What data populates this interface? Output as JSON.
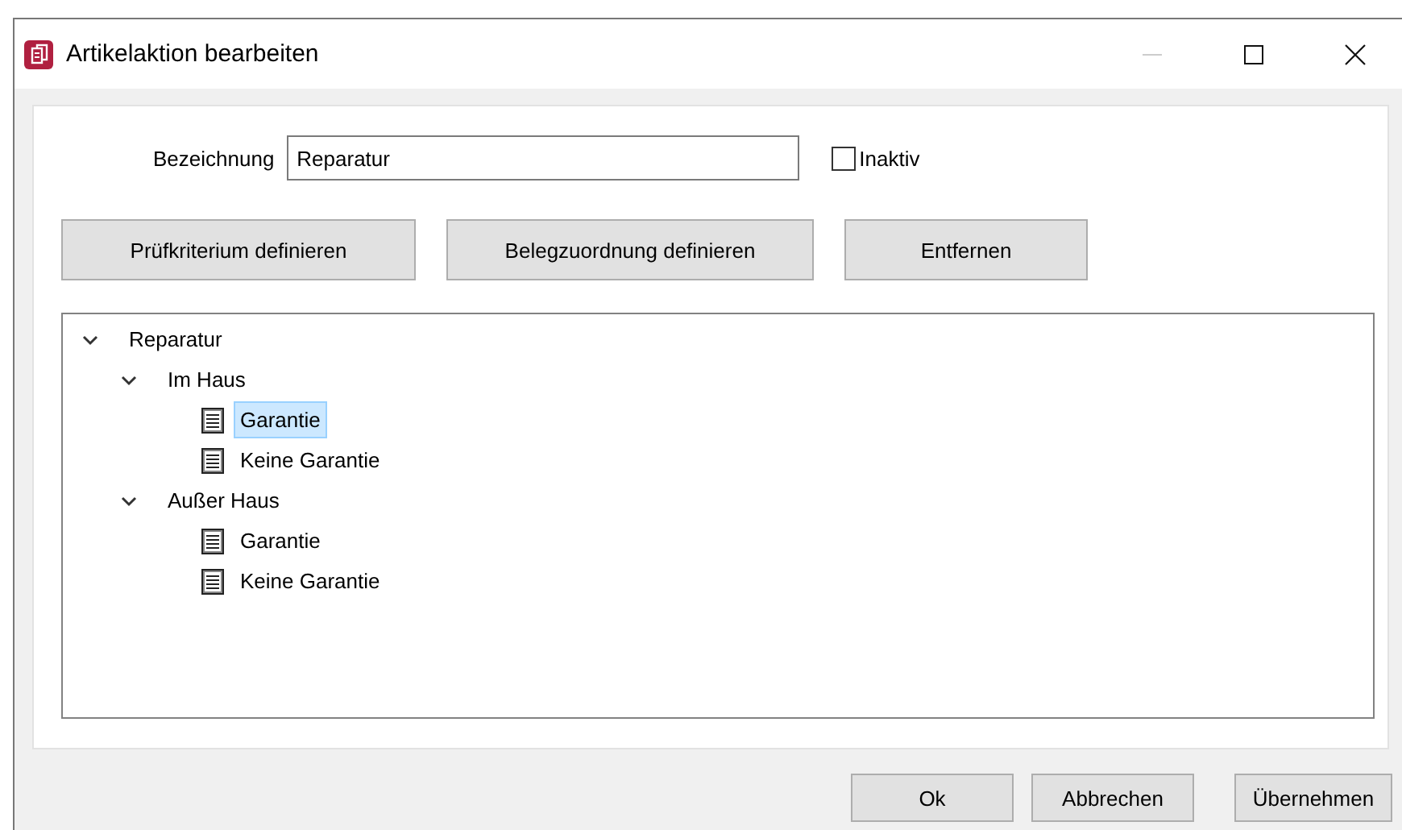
{
  "window": {
    "title": "Artikelaktion bearbeiten"
  },
  "bezeichnung": {
    "label": "Bezeichnung",
    "value": "Reparatur"
  },
  "inaktiv": {
    "label": "Inaktiv",
    "checked": false
  },
  "actions": [
    "Prüfkriterium definieren",
    "Belegzuordnung definieren",
    "Entfernen"
  ],
  "tree": [
    {
      "label": "Reparatur",
      "kind": "folder",
      "expanded": true,
      "selected": false,
      "children": [
        {
          "label": "Im Haus",
          "kind": "folder",
          "expanded": true,
          "selected": false,
          "children": [
            {
              "label": "Garantie",
              "kind": "document",
              "selected": true
            },
            {
              "label": "Keine Garantie",
              "kind": "document",
              "selected": false
            }
          ]
        },
        {
          "label": "Außer Haus",
          "kind": "folder",
          "expanded": true,
          "selected": false,
          "children": [
            {
              "label": "Garantie",
              "kind": "document",
              "selected": false
            },
            {
              "label": "Keine Garantie",
              "kind": "document",
              "selected": false
            }
          ]
        }
      ]
    }
  ],
  "buttons": [
    "Ok",
    "Abbrechen",
    "Übernehmen"
  ]
}
